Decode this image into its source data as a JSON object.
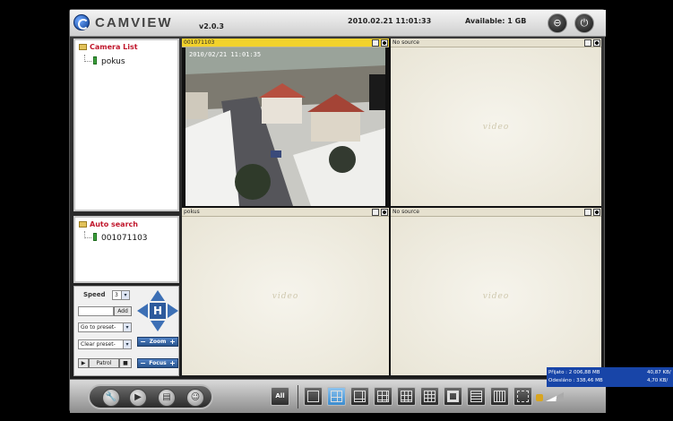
{
  "header": {
    "app_name": "CAMVIEW",
    "version": "v2.0.3",
    "datetime": "2010.02.21 11:01:33",
    "available": "Available: 1 GB",
    "icons": [
      "minimize-icon",
      "power-icon"
    ]
  },
  "camera_list": {
    "title": "Camera List",
    "items": [
      {
        "label": "pokus"
      }
    ]
  },
  "auto_search": {
    "title": "Auto search",
    "items": [
      {
        "label": "001071103"
      }
    ]
  },
  "ptz": {
    "speed_label": "Speed",
    "speed_value": "3",
    "preset_name_value": "",
    "add_label": "Add",
    "goto_preset": "Go to preset-",
    "clear_preset": "Clear preset-",
    "patrol_label": "Patrol",
    "dpad_center": "H",
    "zoom_label": "Zoom",
    "focus_label": "Focus",
    "minus": "−",
    "plus": "+"
  },
  "grid": {
    "cells": [
      {
        "title": "001071103",
        "active": true,
        "osd": "2010/02/21 11:01:35"
      },
      {
        "title": "No source",
        "watermark": "video"
      },
      {
        "title": "pokus",
        "watermark": "video"
      },
      {
        "title": "No source",
        "watermark": "video"
      }
    ]
  },
  "toolbar": {
    "all_label": "All",
    "tools": [
      "wrench-icon",
      "playback-icon",
      "schedule-icon",
      "users-icon"
    ],
    "layouts": [
      "layout-1",
      "layout-4",
      "layout-6",
      "layout-9",
      "layout-10",
      "layout-13",
      "layout-8",
      "layout-16",
      "layout-25",
      "layout-fullscreen"
    ]
  },
  "network": {
    "received_label": "Přijato :",
    "received_value": "2 006,88 MB",
    "received_rate": "40,87 KB/",
    "sent_label": "Odesláno :",
    "sent_value": "338,46 MB",
    "sent_rate": "4,70 KB/"
  },
  "colors": {
    "accent": "#f2d22c",
    "tree_title": "#c0162b",
    "net_bg": "#1845a8",
    "active_layout": "#3a8cd0"
  }
}
